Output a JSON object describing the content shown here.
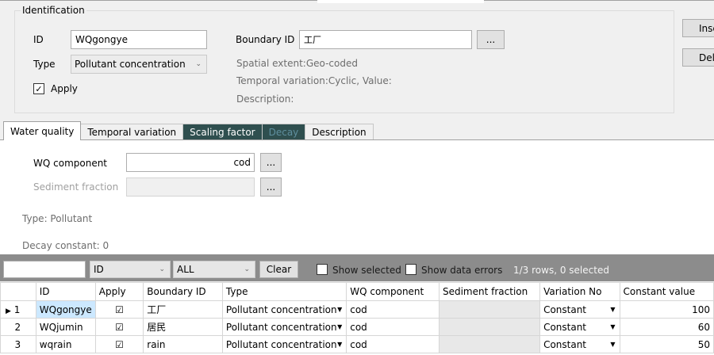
{
  "identification": {
    "group_label": "Identification",
    "id_label": "ID",
    "id_value": "WQgongye",
    "type_label": "Type",
    "type_value": "Pollutant concentration",
    "apply_label": "Apply",
    "apply_checked": true,
    "boundary_id_label": "Boundary ID",
    "boundary_id_value": "工厂",
    "browse_label": "...",
    "spatial_extent": "Spatial extent:Geo-coded",
    "temporal_variation": "Temporal variation:Cyclic, Value:",
    "description": "Description:"
  },
  "side_buttons": {
    "insert": "Inse",
    "delete": "Dele"
  },
  "tabs": [
    {
      "label": "Water quality"
    },
    {
      "label": "Temporal variation"
    },
    {
      "label": "Scaling factor"
    },
    {
      "label": "Decay"
    },
    {
      "label": "Description"
    }
  ],
  "water_quality": {
    "component_label": "WQ component",
    "component_value": "cod",
    "sediment_label": "Sediment fraction",
    "sediment_value": "",
    "browse_label": "...",
    "type_text": "Type: Pollutant",
    "decay_text": "Decay constant: 0"
  },
  "filter": {
    "search_value": "",
    "field_value": "ID",
    "scope_value": "ALL",
    "clear_label": "Clear",
    "show_selected_label": "Show selected",
    "show_errors_label": "Show data errors",
    "status": "1/3 rows, 0 selected"
  },
  "grid": {
    "columns": [
      "ID",
      "Apply",
      "Boundary ID",
      "Type",
      "WQ component",
      "Sediment fraction",
      "Variation No",
      "Constant value"
    ],
    "rows": [
      {
        "n": "1",
        "id": "WQgongye",
        "boundary": "工厂",
        "type": "Pollutant concentration",
        "wq": "cod",
        "sediment": "",
        "variation": "Constant",
        "value": "100"
      },
      {
        "n": "2",
        "id": "WQjumin",
        "boundary": "居民",
        "type": "Pollutant concentration",
        "wq": "cod",
        "sediment": "",
        "variation": "Constant",
        "value": "60"
      },
      {
        "n": "3",
        "id": "wqrain",
        "boundary": "rain",
        "type": "Pollutant concentration",
        "wq": "cod",
        "sediment": "",
        "variation": "Constant",
        "value": "50"
      }
    ]
  },
  "colors": {
    "tab_dark": "#2f4f4f",
    "filter_bar": "#8c8c8c",
    "selection": "#cce8ff"
  },
  "icons": {
    "dropdown": "chevron-down-icon",
    "row_pointer": "triangle-right-icon",
    "checkmark": "check-icon"
  }
}
